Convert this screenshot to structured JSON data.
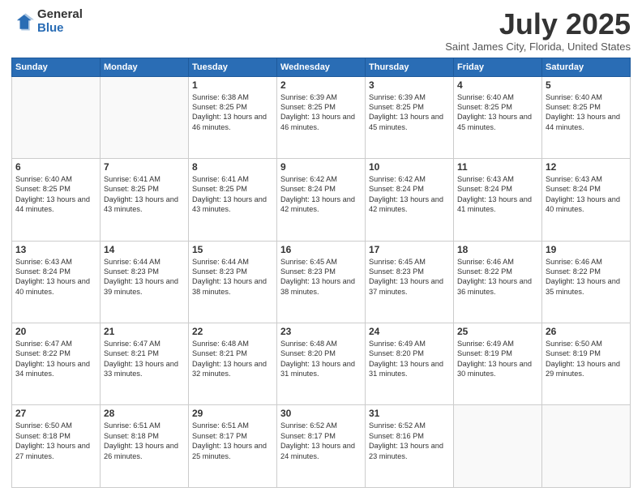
{
  "logo": {
    "general": "General",
    "blue": "Blue"
  },
  "title": {
    "month_year": "July 2025",
    "location": "Saint James City, Florida, United States"
  },
  "days_of_week": [
    "Sunday",
    "Monday",
    "Tuesday",
    "Wednesday",
    "Thursday",
    "Friday",
    "Saturday"
  ],
  "weeks": [
    [
      {
        "day": "",
        "info": ""
      },
      {
        "day": "",
        "info": ""
      },
      {
        "day": "1",
        "info": "Sunrise: 6:38 AM\nSunset: 8:25 PM\nDaylight: 13 hours and 46 minutes."
      },
      {
        "day": "2",
        "info": "Sunrise: 6:39 AM\nSunset: 8:25 PM\nDaylight: 13 hours and 46 minutes."
      },
      {
        "day": "3",
        "info": "Sunrise: 6:39 AM\nSunset: 8:25 PM\nDaylight: 13 hours and 45 minutes."
      },
      {
        "day": "4",
        "info": "Sunrise: 6:40 AM\nSunset: 8:25 PM\nDaylight: 13 hours and 45 minutes."
      },
      {
        "day": "5",
        "info": "Sunrise: 6:40 AM\nSunset: 8:25 PM\nDaylight: 13 hours and 44 minutes."
      }
    ],
    [
      {
        "day": "6",
        "info": "Sunrise: 6:40 AM\nSunset: 8:25 PM\nDaylight: 13 hours and 44 minutes."
      },
      {
        "day": "7",
        "info": "Sunrise: 6:41 AM\nSunset: 8:25 PM\nDaylight: 13 hours and 43 minutes."
      },
      {
        "day": "8",
        "info": "Sunrise: 6:41 AM\nSunset: 8:25 PM\nDaylight: 13 hours and 43 minutes."
      },
      {
        "day": "9",
        "info": "Sunrise: 6:42 AM\nSunset: 8:24 PM\nDaylight: 13 hours and 42 minutes."
      },
      {
        "day": "10",
        "info": "Sunrise: 6:42 AM\nSunset: 8:24 PM\nDaylight: 13 hours and 42 minutes."
      },
      {
        "day": "11",
        "info": "Sunrise: 6:43 AM\nSunset: 8:24 PM\nDaylight: 13 hours and 41 minutes."
      },
      {
        "day": "12",
        "info": "Sunrise: 6:43 AM\nSunset: 8:24 PM\nDaylight: 13 hours and 40 minutes."
      }
    ],
    [
      {
        "day": "13",
        "info": "Sunrise: 6:43 AM\nSunset: 8:24 PM\nDaylight: 13 hours and 40 minutes."
      },
      {
        "day": "14",
        "info": "Sunrise: 6:44 AM\nSunset: 8:23 PM\nDaylight: 13 hours and 39 minutes."
      },
      {
        "day": "15",
        "info": "Sunrise: 6:44 AM\nSunset: 8:23 PM\nDaylight: 13 hours and 38 minutes."
      },
      {
        "day": "16",
        "info": "Sunrise: 6:45 AM\nSunset: 8:23 PM\nDaylight: 13 hours and 38 minutes."
      },
      {
        "day": "17",
        "info": "Sunrise: 6:45 AM\nSunset: 8:23 PM\nDaylight: 13 hours and 37 minutes."
      },
      {
        "day": "18",
        "info": "Sunrise: 6:46 AM\nSunset: 8:22 PM\nDaylight: 13 hours and 36 minutes."
      },
      {
        "day": "19",
        "info": "Sunrise: 6:46 AM\nSunset: 8:22 PM\nDaylight: 13 hours and 35 minutes."
      }
    ],
    [
      {
        "day": "20",
        "info": "Sunrise: 6:47 AM\nSunset: 8:22 PM\nDaylight: 13 hours and 34 minutes."
      },
      {
        "day": "21",
        "info": "Sunrise: 6:47 AM\nSunset: 8:21 PM\nDaylight: 13 hours and 33 minutes."
      },
      {
        "day": "22",
        "info": "Sunrise: 6:48 AM\nSunset: 8:21 PM\nDaylight: 13 hours and 32 minutes."
      },
      {
        "day": "23",
        "info": "Sunrise: 6:48 AM\nSunset: 8:20 PM\nDaylight: 13 hours and 31 minutes."
      },
      {
        "day": "24",
        "info": "Sunrise: 6:49 AM\nSunset: 8:20 PM\nDaylight: 13 hours and 31 minutes."
      },
      {
        "day": "25",
        "info": "Sunrise: 6:49 AM\nSunset: 8:19 PM\nDaylight: 13 hours and 30 minutes."
      },
      {
        "day": "26",
        "info": "Sunrise: 6:50 AM\nSunset: 8:19 PM\nDaylight: 13 hours and 29 minutes."
      }
    ],
    [
      {
        "day": "27",
        "info": "Sunrise: 6:50 AM\nSunset: 8:18 PM\nDaylight: 13 hours and 27 minutes."
      },
      {
        "day": "28",
        "info": "Sunrise: 6:51 AM\nSunset: 8:18 PM\nDaylight: 13 hours and 26 minutes."
      },
      {
        "day": "29",
        "info": "Sunrise: 6:51 AM\nSunset: 8:17 PM\nDaylight: 13 hours and 25 minutes."
      },
      {
        "day": "30",
        "info": "Sunrise: 6:52 AM\nSunset: 8:17 PM\nDaylight: 13 hours and 24 minutes."
      },
      {
        "day": "31",
        "info": "Sunrise: 6:52 AM\nSunset: 8:16 PM\nDaylight: 13 hours and 23 minutes."
      },
      {
        "day": "",
        "info": ""
      },
      {
        "day": "",
        "info": ""
      }
    ]
  ]
}
